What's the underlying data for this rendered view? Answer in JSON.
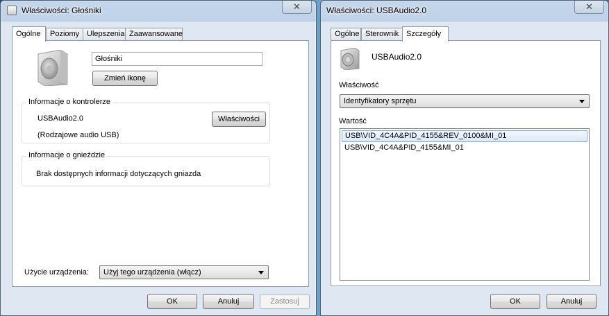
{
  "window1": {
    "title": "Właściwości: Głośniki",
    "close_glyph": "✕",
    "tabs": [
      {
        "label": "Ogólne"
      },
      {
        "label": "Poziomy"
      },
      {
        "label": "Ulepszenia"
      },
      {
        "label": "Zaawansowane"
      }
    ],
    "device_name_value": "Głośniki",
    "change_icon_label": "Zmień ikonę",
    "controller_group": {
      "label": "Informacje o kontrolerze",
      "controller_name": "USBAudio2.0",
      "controller_desc": "(Rodzajowe audio USB)",
      "properties_label": "Właściwości"
    },
    "jack_group": {
      "label": "Informacje o gnieździe",
      "message": "Brak dostępnych informacji dotyczących gniazda"
    },
    "usage_label": "Użycie urządzenia:",
    "usage_value": "Użyj tego urządzenia (włącz)",
    "buttons": {
      "ok": "OK",
      "cancel": "Anuluj",
      "apply": "Zastosuj"
    }
  },
  "window2": {
    "title": "Właściwości: USBAudio2.0",
    "close_glyph": "✕",
    "tabs": [
      {
        "label": "Ogólne"
      },
      {
        "label": "Sterownik"
      },
      {
        "label": "Szczegóły"
      }
    ],
    "device_name": "USBAudio2.0",
    "property_label": "Właściwość",
    "property_value": "Identyfikatory sprzętu",
    "value_label": "Wartość",
    "values": [
      "USB\\VID_4C4A&PID_4155&REV_0100&MI_01",
      "USB\\VID_4C4A&PID_4155&MI_01"
    ],
    "buttons": {
      "ok": "OK",
      "cancel": "Anuluj"
    }
  }
}
